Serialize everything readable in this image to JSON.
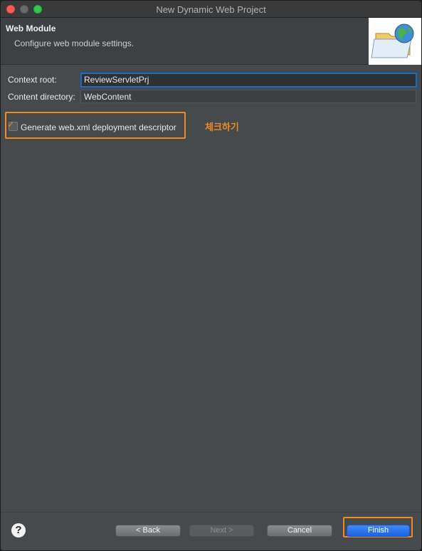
{
  "window": {
    "title": "New Dynamic Web Project"
  },
  "header": {
    "title": "Web Module",
    "description": "Configure web module settings.",
    "wizard_icon": "folder-globe-icon"
  },
  "form": {
    "context_root_label": "Context root:",
    "context_root_value": "ReviewServletPrj",
    "content_directory_label": "Content directory:",
    "content_directory_value": "WebContent",
    "generate_descriptor_label": "Generate web.xml deployment descriptor",
    "generate_descriptor_checked": true
  },
  "annotation": {
    "note": "체크하기",
    "color": "#f08a24"
  },
  "buttons": {
    "help": "?",
    "back": "< Back",
    "next": "Next >",
    "cancel": "Cancel",
    "finish": "Finish"
  },
  "colors": {
    "accent": "#f08a24",
    "focus": "#2d6aa8",
    "primary_button": "#1c63e0"
  }
}
